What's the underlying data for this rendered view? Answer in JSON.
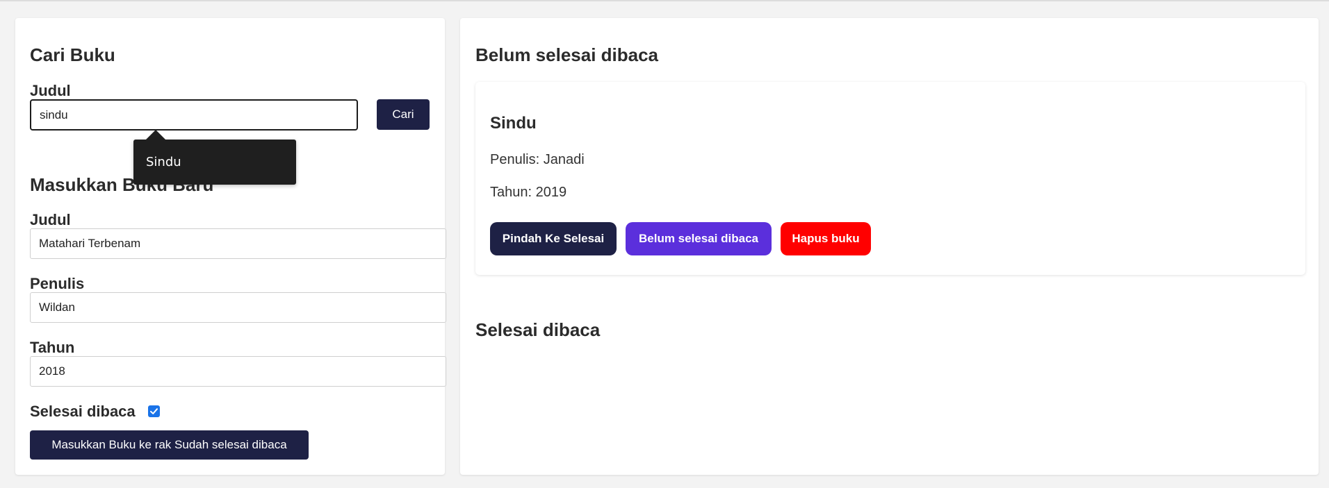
{
  "search": {
    "heading": "Cari Buku",
    "title_label": "Judul",
    "query": "sindu",
    "button_label": "Cari",
    "suggestion": "Sindu"
  },
  "new_book": {
    "heading": "Masukkan Buku Baru",
    "title_label": "Judul",
    "title_value": "Matahari Terbenam",
    "author_label": "Penulis",
    "author_value": "Wildan",
    "year_label": "Tahun",
    "year_value": "2018",
    "finished_label": "Selesai dibaca",
    "finished_checked": true,
    "submit_label": "Masukkan Buku ke rak Sudah selesai dibaca"
  },
  "shelves": {
    "unfinished_heading": "Belum selesai dibaca",
    "finished_heading": "Selesai dibaca"
  },
  "books_unfinished": [
    {
      "title": "Sindu",
      "author_text": "Penulis: Janadi",
      "year_text": "Tahun: 2019",
      "actions": {
        "move": "Pindah Ke Selesai",
        "status": "Belum selesai dibaca",
        "delete": "Hapus buku"
      }
    }
  ],
  "colors": {
    "primary_dark": "#1e2145",
    "purple": "#5b2fdc",
    "red": "#ff0000",
    "checkbox": "#1a73e8"
  }
}
